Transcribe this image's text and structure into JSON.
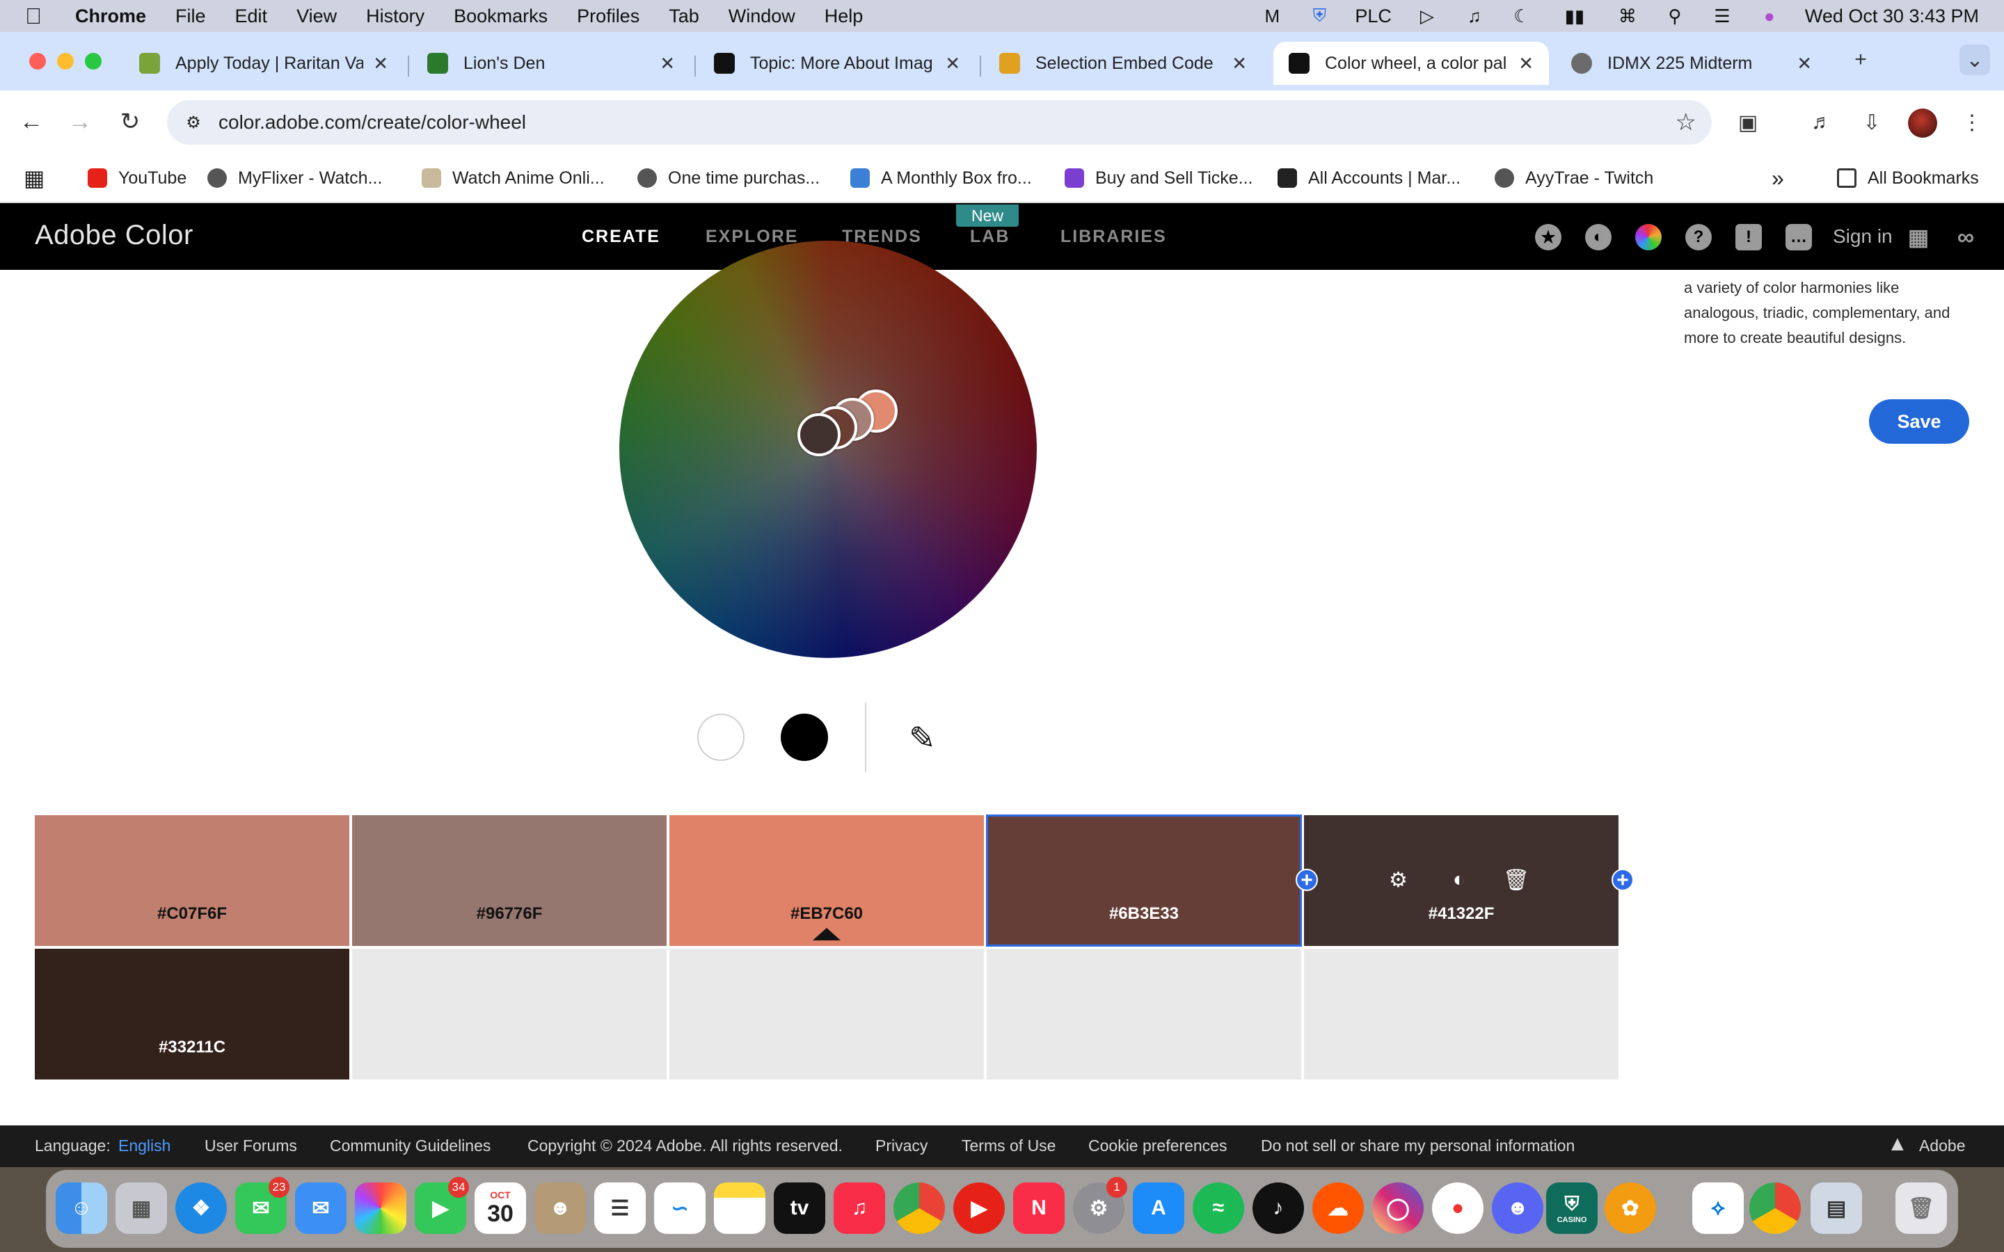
{
  "menubar": {
    "app": "Chrome",
    "items": [
      "File",
      "Edit",
      "View",
      "History",
      "Bookmarks",
      "Profiles",
      "Tab",
      "Window",
      "Help"
    ],
    "plc": "PLC",
    "datetime": "Wed Oct 30  3:43 PM"
  },
  "tabs": [
    {
      "title": "Apply Today | Raritan Va",
      "favicon_color": "#7aa33a"
    },
    {
      "title": "Lion's Den",
      "favicon_color": "#2b7a2b"
    },
    {
      "title": "Topic: More About Imag",
      "favicon_color": "#111111"
    },
    {
      "title": "Selection Embed Code",
      "favicon_color": "#e0a020"
    },
    {
      "title": "Color wheel, a color pal",
      "favicon_color": "#111111"
    },
    {
      "title": "IDMX 225 Midterm",
      "favicon_color": "#6b6b6b"
    }
  ],
  "url": "color.adobe.com/create/color-wheel",
  "bookmarks": [
    {
      "label": "YouTube",
      "color": "#e62117"
    },
    {
      "label": "MyFlixer - Watch...",
      "color": "#555555"
    },
    {
      "label": "Watch Anime Onli...",
      "color": "#c8b99a"
    },
    {
      "label": "One time purchas...",
      "color": "#555555"
    },
    {
      "label": "A Monthly Box fro...",
      "color": "#3b7fd6"
    },
    {
      "label": "Buy and Sell Ticke...",
      "color": "#7a3fd0"
    },
    {
      "label": "All Accounts | Mar...",
      "color": "#222222"
    },
    {
      "label": "AyyTrae - Twitch",
      "color": "#555555"
    }
  ],
  "all_bookmarks": "All Bookmarks",
  "adobe": {
    "brand": "Adobe Color",
    "nav": [
      "CREATE",
      "EXPLORE",
      "TRENDS",
      "LAB",
      "LIBRARIES"
    ],
    "new_badge": "New",
    "sign_in": "Sign in"
  },
  "description": "a variety of color harmonies like analogous, triadic, complementary, and more to create beautiful designs.",
  "save_label": "Save",
  "swatches": [
    {
      "hex": "#C07F6F",
      "color": "#C07F6F",
      "text_color": "#111111"
    },
    {
      "hex": "#96776F",
      "color": "#96776F",
      "text_color": "#111111"
    },
    {
      "hex": "#EB7C60",
      "color": "#DF8267",
      "text_color": "#111111"
    },
    {
      "hex": "#6B3E33",
      "color": "#653F37",
      "text_color": "#ffffff"
    },
    {
      "hex": "#41322F",
      "color": "#40312E",
      "text_color": "#ffffff"
    },
    {
      "hex": "#33211C",
      "color": "#33211C",
      "text_color": "#ffffff"
    }
  ],
  "footer": {
    "language_label": "Language:",
    "language": "English",
    "links": [
      "User Forums",
      "Community Guidelines",
      "Copyright © 2024 Adobe. All rights reserved.",
      "Privacy",
      "Terms of Use",
      "Cookie preferences",
      "Do not sell or share my personal information"
    ],
    "adobe": "Adobe"
  },
  "dock": {
    "messages_badge": "23",
    "facetime_badge": "34",
    "settings_badge": "1",
    "calendar_month": "OCT",
    "calendar_day": "30",
    "casino_label": "CASINO"
  }
}
